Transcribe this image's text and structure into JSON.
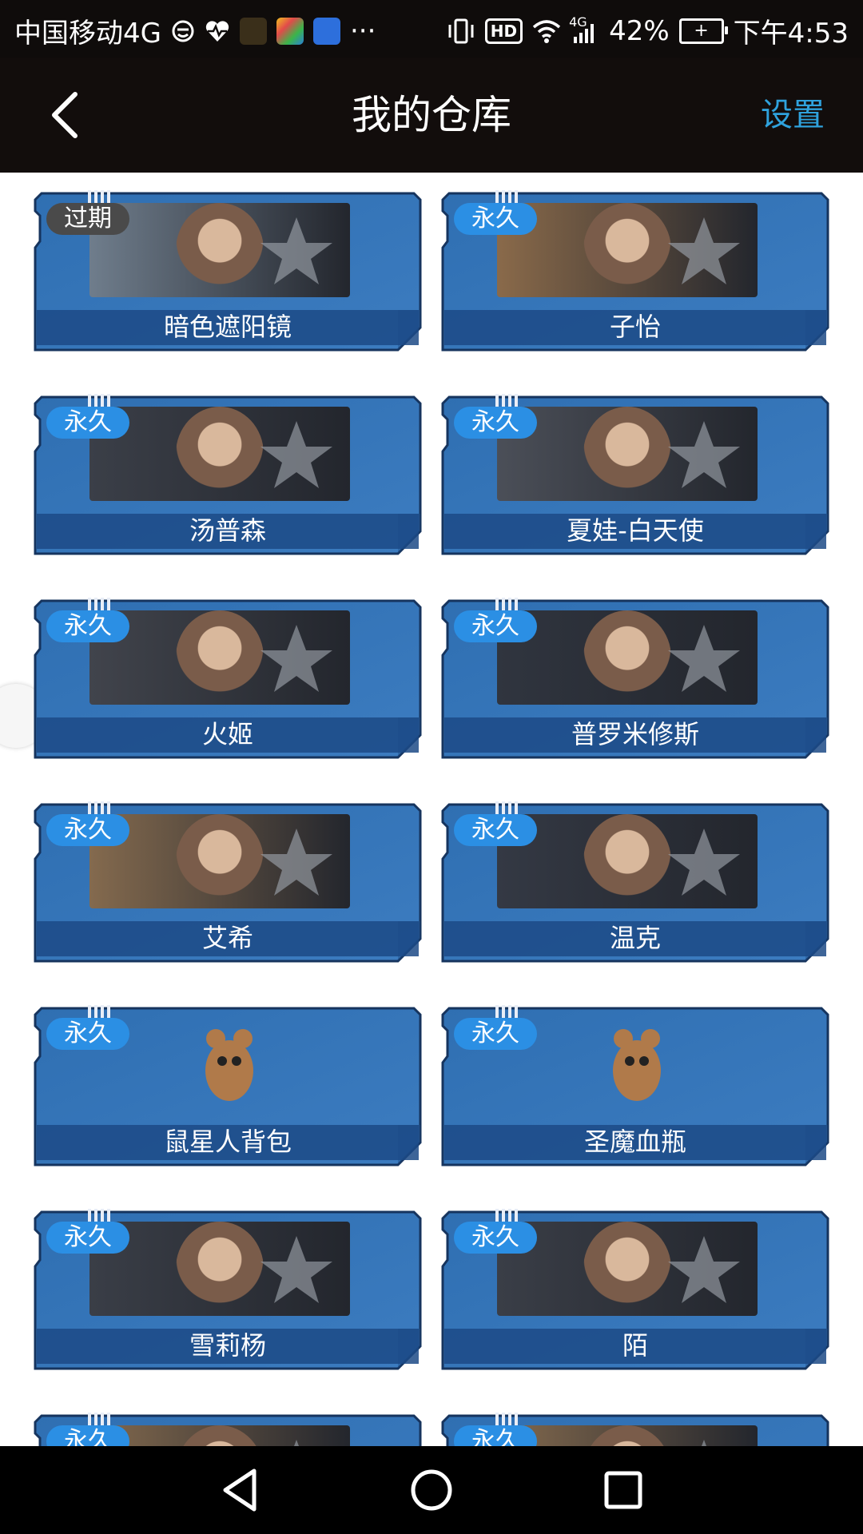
{
  "status_bar": {
    "carrier": "中国移动4G",
    "more": "···",
    "hd": "HD",
    "network": "4G",
    "battery_percent": "42%",
    "time": "下午4:53"
  },
  "header": {
    "title": "我的仓库",
    "settings_label": "设置"
  },
  "items": [
    {
      "badge": "过期",
      "name": "暗色遮阳镜",
      "expired": true,
      "art": "#6f7d8c"
    },
    {
      "badge": "永久",
      "name": "子怡",
      "expired": false,
      "art": "#8a6a4a"
    },
    {
      "badge": "永久",
      "name": "汤普森",
      "expired": false,
      "art": "#3b3f48"
    },
    {
      "badge": "永久",
      "name": "夏娃-白天使",
      "expired": false,
      "art": "#4b4f58"
    },
    {
      "badge": "永久",
      "name": "火姬",
      "expired": false,
      "art": "#41444c"
    },
    {
      "badge": "永久",
      "name": "普罗米修斯",
      "expired": false,
      "art": "#30353f"
    },
    {
      "badge": "永久",
      "name": "艾希",
      "expired": false,
      "art": "#846a4e"
    },
    {
      "badge": "永久",
      "name": "温克",
      "expired": false,
      "art": "#343944"
    },
    {
      "badge": "永久",
      "name": "鼠星人背包",
      "expired": false,
      "art": ""
    },
    {
      "badge": "永久",
      "name": "圣魔血瓶",
      "expired": false,
      "art": ""
    },
    {
      "badge": "永久",
      "name": "雪莉杨",
      "expired": false,
      "art": "#3a3e47"
    },
    {
      "badge": "永久",
      "name": "陌",
      "expired": false,
      "art": "#3a3e47"
    },
    {
      "badge": "永久",
      "name": "",
      "expired": false,
      "art": "#846a4e"
    },
    {
      "badge": "永久",
      "name": "",
      "expired": false,
      "art": "#846a4e"
    }
  ],
  "colors": {
    "card_blue": "#2f6fb2",
    "card_dark": "#1c4a86",
    "badge_blue": "#2b8fe4",
    "badge_expired": "#4a4a4a",
    "accent": "#2fa2dd"
  },
  "icons": {
    "back": "chevron-left-icon",
    "nav_back": "triangle-back-icon",
    "nav_home": "circle-home-icon",
    "nav_recent": "square-recent-icon"
  }
}
